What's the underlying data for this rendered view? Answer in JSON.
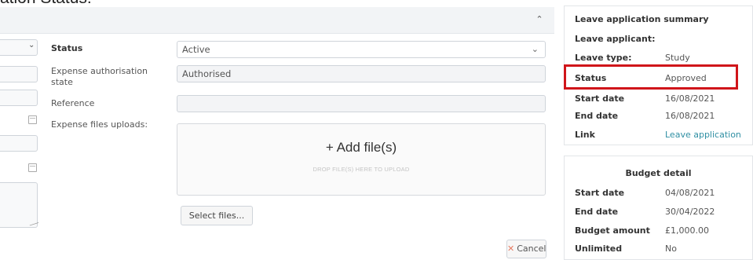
{
  "heading": "ation Status:",
  "form": {
    "status_label": "Status",
    "status_value": "Active",
    "auth_label": "Expense authorisation state",
    "auth_value": "Authorised",
    "reference_label": "Reference",
    "reference_value": "",
    "uploads_label": "Expense files uploads:",
    "dropzone_title": "+ Add file(s)",
    "dropzone_hint": "DROP FILE(S) HERE TO UPLOAD",
    "select_files_label": "Select files...",
    "cancel_label": "Cancel"
  },
  "leave_summary": {
    "title": "Leave application summary",
    "rows": [
      {
        "key": "Leave applicant:",
        "value": ""
      },
      {
        "key": "Leave type:",
        "value": "Study"
      },
      {
        "key": "Status",
        "value": "Approved"
      },
      {
        "key": "Start date",
        "value": "16/08/2021"
      },
      {
        "key": "End date",
        "value": "16/08/2021"
      },
      {
        "key": "Link",
        "value": "Leave application"
      }
    ]
  },
  "budget_detail": {
    "title": "Budget detail",
    "rows": [
      {
        "key": "Start date",
        "value": "04/08/2021"
      },
      {
        "key": "End date",
        "value": "30/04/2022"
      },
      {
        "key": "Budget amount",
        "value": "£1,000.00"
      },
      {
        "key": "Unlimited",
        "value": "No"
      }
    ]
  },
  "colors": {
    "highlight": "#d0151a",
    "link": "#2f8fa3",
    "cancel_icon": "#e67c63"
  },
  "icons": [
    "chevron-up-icon",
    "chevron-down-icon",
    "calendar-icon",
    "close-icon",
    "resize-grip-icon"
  ]
}
